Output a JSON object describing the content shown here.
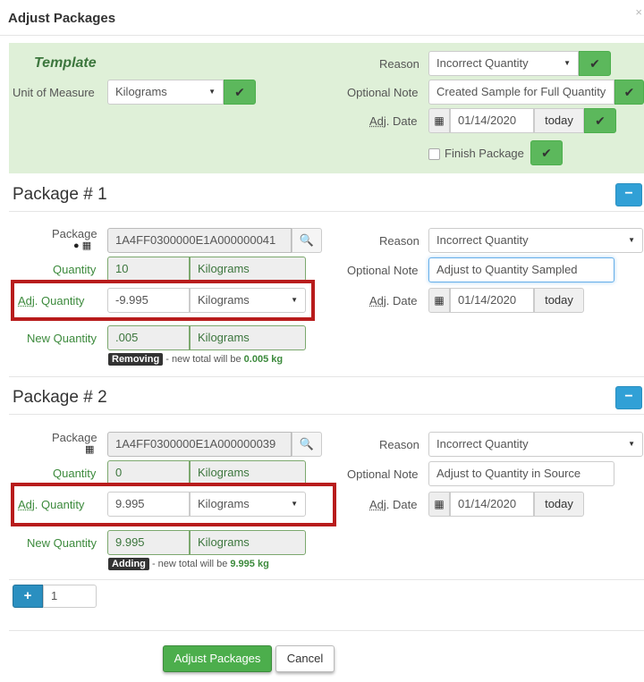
{
  "dialog": {
    "title": "Adjust Packages",
    "close_glyph": "×"
  },
  "template": {
    "title": "Template",
    "unit_label": "Unit of Measure",
    "unit_value": "Kilograms",
    "reason_label": "Reason",
    "reason_value": "Incorrect Quantity",
    "note_label": "Optional Note",
    "note_value": "Created Sample for Full Quantity",
    "date_label_prefix": "Adj",
    "date_label_suffix": ". Date",
    "date_value": "01/14/2020",
    "today_label": "today",
    "finish_label": "Finish Package"
  },
  "packages": [
    {
      "title": "Package # 1",
      "package_label": "Package",
      "package_id": "1A4FF0300000E1A000000041",
      "quantity_label": "Quantity",
      "quantity_value": "10",
      "quantity_unit": "Kilograms",
      "adj_label_prefix": "Adj",
      "adj_label_suffix": ". Quantity",
      "adj_value": "-9.995",
      "adj_unit": "Kilograms",
      "new_label": "New Quantity",
      "new_value": ".005",
      "new_unit": "Kilograms",
      "badge": "Removing",
      "hint_text": " - new total will be ",
      "hint_total": "0.005 kg",
      "reason_label": "Reason",
      "reason_value": "Incorrect Quantity",
      "note_label": "Optional Note",
      "note_value": "Adjust to Quantity Sampled",
      "date_label_prefix": "Adj",
      "date_label_suffix": ". Date",
      "date_value": "01/14/2020",
      "today_label": "today",
      "minus": "−"
    },
    {
      "title": "Package # 2",
      "package_label": "Package",
      "package_id": "1A4FF0300000E1A000000039",
      "quantity_label": "Quantity",
      "quantity_value": "0",
      "quantity_unit": "Kilograms",
      "adj_label_prefix": "Adj",
      "adj_label_suffix": ". Quantity",
      "adj_value": "9.995",
      "adj_unit": "Kilograms",
      "new_label": "New Quantity",
      "new_value": "9.995",
      "new_unit": "Kilograms",
      "badge": "Adding",
      "hint_text": " - new total will be ",
      "hint_total": "9.995 kg",
      "reason_label": "Reason",
      "reason_value": "Incorrect Quantity",
      "note_label": "Optional Note",
      "note_value": "Adjust to Quantity in Source",
      "date_label_prefix": "Adj",
      "date_label_suffix": ". Date",
      "date_value": "01/14/2020",
      "today_label": "today",
      "minus": "−"
    }
  ],
  "add_row": {
    "plus": "+",
    "count_value": "1"
  },
  "footer": {
    "submit_label": "Adjust Packages",
    "cancel_label": "Cancel"
  },
  "colors": {
    "accent_green": "#5cb85c",
    "template_bg": "#dff0d8",
    "info_blue": "#31a0d6",
    "highlight_red": "#b81c1c"
  },
  "icons": {
    "check": "✔",
    "caret": "▼",
    "calendar": "▦",
    "search": "🔍"
  }
}
